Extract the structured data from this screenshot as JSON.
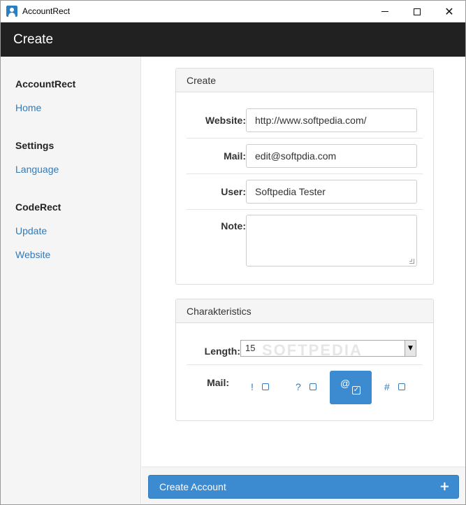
{
  "window": {
    "title": "AccountRect"
  },
  "header": {
    "title": "Create"
  },
  "sidebar": {
    "sections": [
      {
        "heading": "AccountRect",
        "links": [
          "Home"
        ]
      },
      {
        "heading": "Settings",
        "links": [
          "Language"
        ]
      },
      {
        "heading": "CodeRect",
        "links": [
          "Update",
          "Website"
        ]
      }
    ]
  },
  "create_panel": {
    "title": "Create",
    "website_label": "Website:",
    "website_value": "http://www.softpedia.com/",
    "mail_label": "Mail:",
    "mail_value": "edit@softpdia.com",
    "user_label": "User:",
    "user_value": "Softpedia Tester",
    "note_label": "Note:",
    "note_value": ""
  },
  "char_panel": {
    "title": "Charakteristics",
    "length_label": "Length:",
    "length_value": "15",
    "mail_label": "Mail:",
    "options": [
      {
        "symbol": "!",
        "checked": false
      },
      {
        "symbol": "?",
        "checked": false
      },
      {
        "symbol": "@",
        "checked": true
      },
      {
        "symbol": "#",
        "checked": false
      }
    ],
    "watermark": "SOFTPEDIA"
  },
  "footer": {
    "create_label": "Create Account"
  },
  "colors": {
    "accent": "#3c8ad0",
    "link": "#337ab7",
    "header_bg": "#212121"
  },
  "icons": {
    "app": "user-icon",
    "create": "plus-icon"
  }
}
